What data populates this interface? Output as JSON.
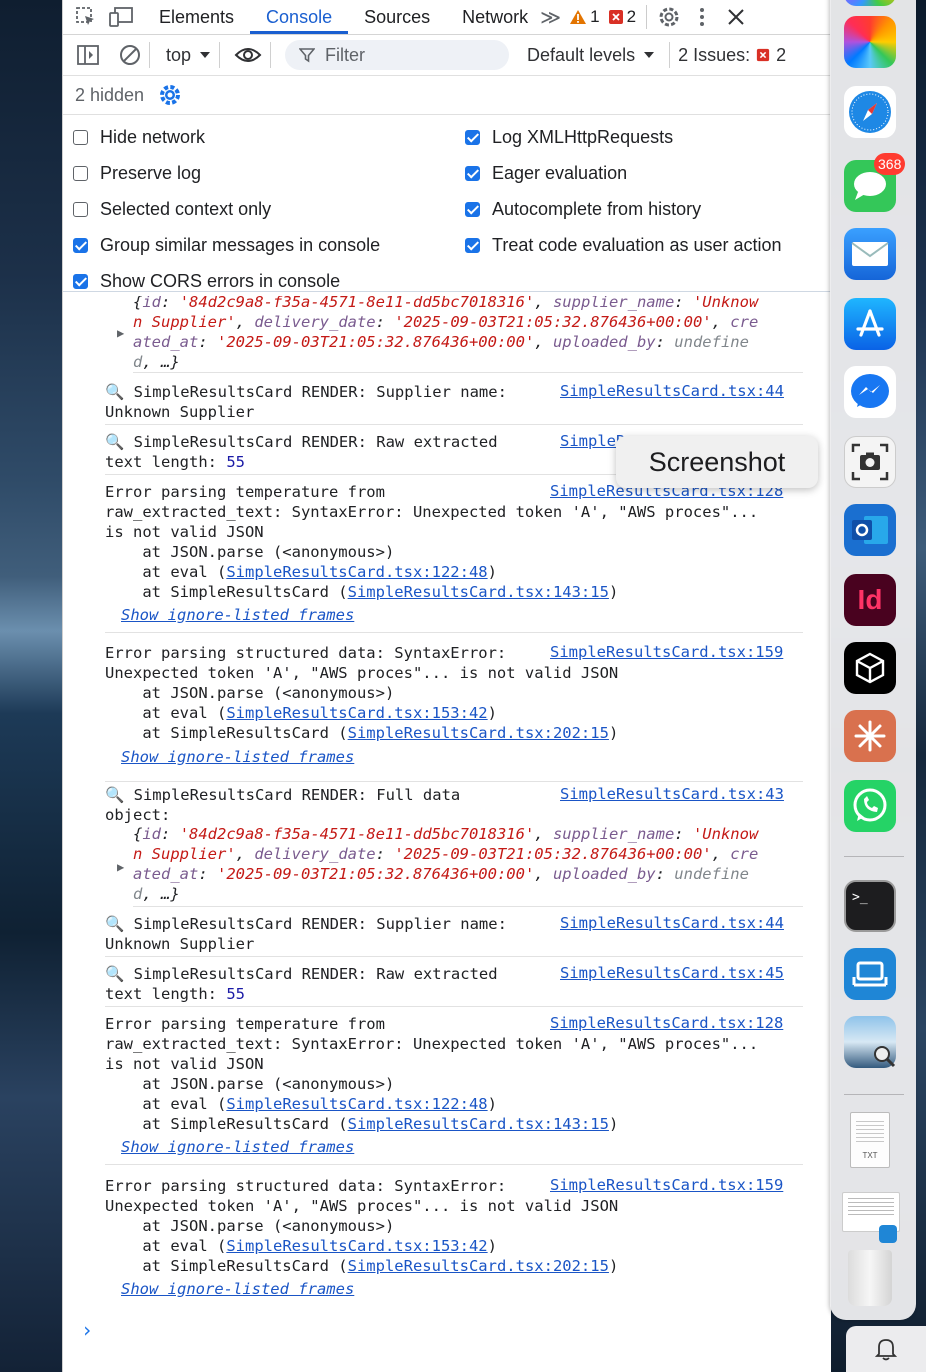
{
  "tabs": {
    "elements": "Elements",
    "console": "Console",
    "sources": "Sources",
    "network": "Network",
    "more": "≫",
    "warnings": "1",
    "errors": "2"
  },
  "toolbar": {
    "context": "top",
    "filter_placeholder": "Filter",
    "levels": "Default levels",
    "issues_label": "2 Issues:",
    "issues_count": "2"
  },
  "hidden": "2 hidden",
  "settings": [
    {
      "label": "Hide network",
      "checked": false
    },
    {
      "label": "Log XMLHttpRequests",
      "checked": true
    },
    {
      "label": "Preserve log",
      "checked": false
    },
    {
      "label": "Eager evaluation",
      "checked": true
    },
    {
      "label": "Selected context only",
      "checked": false
    },
    {
      "label": "Autocomplete from history",
      "checked": true
    },
    {
      "label": "Group similar messages in console",
      "checked": true
    },
    {
      "label": "Treat code evaluation as user action",
      "checked": true
    },
    {
      "label": "Show CORS errors in console",
      "checked": true
    }
  ],
  "console": {
    "obj_id": "'84d2c9a8-f35a-4571-8e11-dd5bc7018316'",
    "obj_supplier_a": "'Unknow",
    "obj_supplier_b": "n Supplier'",
    "obj_date": "'2025-09-03T21:05:32.876436+00:00'",
    "obj_cre_a": "cre",
    "obj_cre_b": "ated_at",
    "obj_undef_a": "undefine",
    "obj_undef_b": "d",
    "supplier_msg_a": "🔍 SimpleResultsCard RENDER: Supplier name:",
    "supplier_msg_b": "Unknown Supplier",
    "raw_msg_a": "🔍 SimpleResultsCard RENDER: Raw extracted",
    "raw_msg_b": "text length: ",
    "raw_len": "55",
    "full_msg_a": "🔍 SimpleResultsCard RENDER: Full data",
    "full_msg_b": "object:",
    "err_temp_a": "Error parsing temperature from",
    "err_temp_b": "raw_extracted_text: SyntaxError: Unexpected token 'A', \"AWS proces\"...",
    "err_temp_c": "is not valid JSON",
    "err_struct_a": "Error parsing structured data: SyntaxError:",
    "err_struct_b": "Unexpected token 'A', \"AWS proces\"... is not valid JSON",
    "at_parse": "    at JSON.parse (<anonymous>)",
    "at_eval": "    at eval (",
    "at_card": "    at SimpleResultsCard (",
    "show_ignored": "Show ignore-listed frames",
    "link_44": "SimpleResultsCard.tsx:44",
    "link_43": "SimpleResultsCard.tsx:43",
    "link_45": "SimpleResultsCard.tsx:45",
    "link_128": "SimpleResultsCard.tsx:128",
    "link_159": "SimpleResultsCard.tsx:159",
    "link_122": "SimpleResultsCard.tsx:122:48",
    "link_143": "SimpleResultsCard.tsx:143:15",
    "link_153": "SimpleResultsCard.tsx:153:42",
    "link_202": "SimpleResultsCard.tsx:202:15",
    "link_partial": "SimpleR"
  },
  "tooltip": "Screenshot",
  "dock": {
    "messages_badge": "368",
    "indesign": "Id",
    "txt_label": "TXT"
  }
}
